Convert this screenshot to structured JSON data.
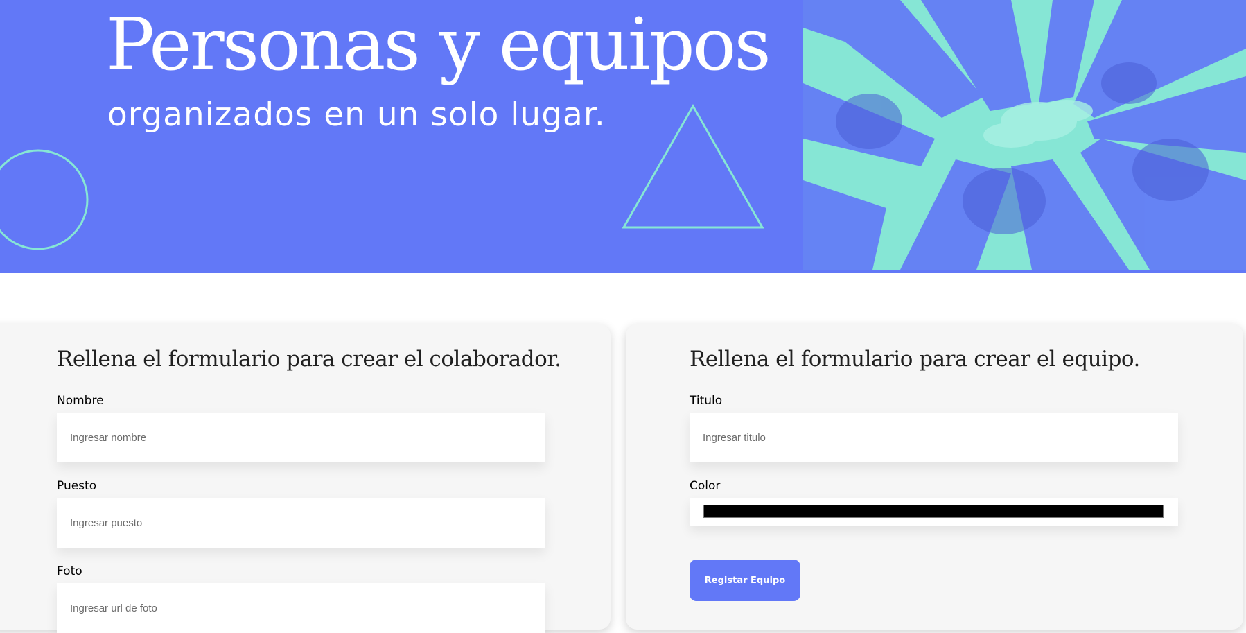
{
  "hero": {
    "title": "Personas y equipos",
    "subtitle": "organizados en un solo lugar.",
    "background_color": "#6278f7",
    "decoration_color": "#86e6d5",
    "photo_tint": "#86e6d5"
  },
  "collaborator_form": {
    "heading": "Rellena el formulario para crear el colaborador.",
    "fields": [
      {
        "label": "Nombre",
        "placeholder": "Ingresar nombre"
      },
      {
        "label": "Puesto",
        "placeholder": "Ingresar puesto"
      },
      {
        "label": "Foto",
        "placeholder": "Ingresar url de foto"
      }
    ]
  },
  "team_form": {
    "heading": "Rellena el formulario para crear el equipo.",
    "title_field": {
      "label": "Titulo",
      "placeholder": "Ingresar titulo"
    },
    "color_field": {
      "label": "Color",
      "value": "#000000"
    },
    "submit_label": "Registar Equipo",
    "button_color": "#6278f7"
  }
}
